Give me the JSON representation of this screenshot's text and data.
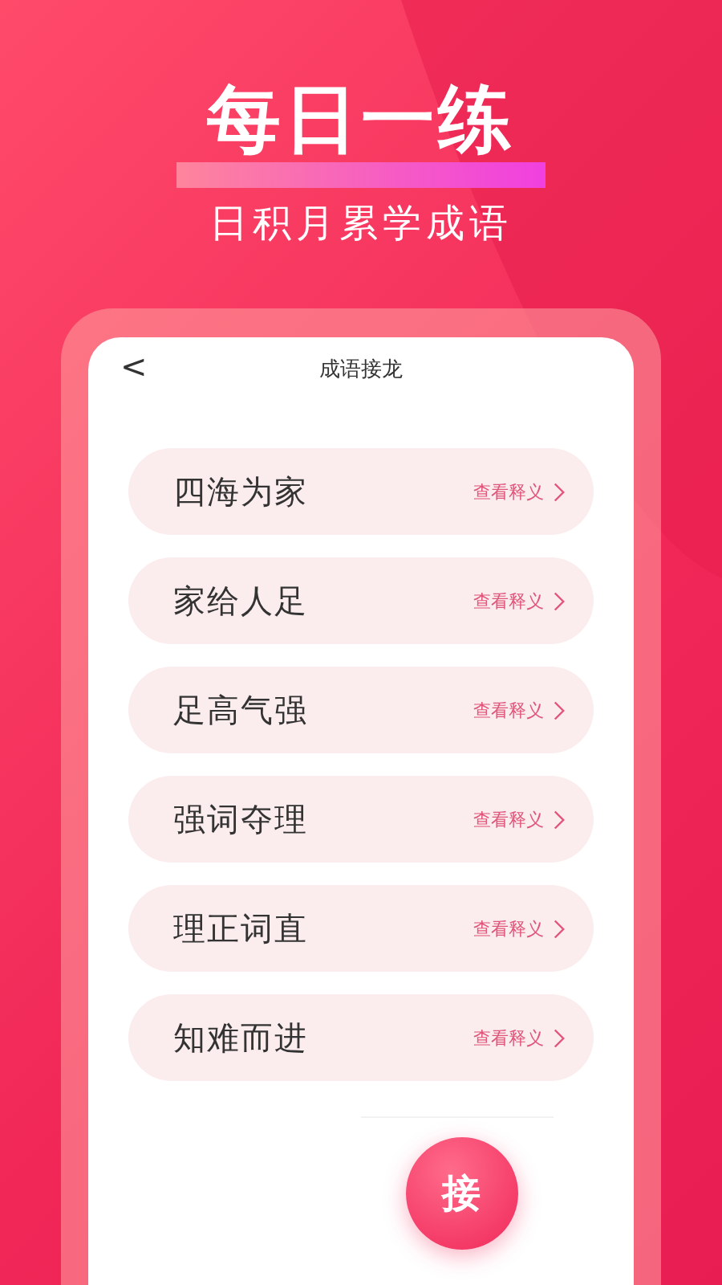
{
  "headline": "每日一练",
  "subtitle": "日积月累学成语",
  "screen": {
    "back": "<",
    "title": "成语接龙",
    "idioms": [
      {
        "text": "四海为家",
        "action": "查看释义"
      },
      {
        "text": "家给人足",
        "action": "查看释义"
      },
      {
        "text": "足高气强",
        "action": "查看释义"
      },
      {
        "text": "强词夺理",
        "action": "查看释义"
      },
      {
        "text": "理正词直",
        "action": "查看释义"
      },
      {
        "text": "知难而进",
        "action": "查看释义"
      }
    ],
    "fab": "接"
  }
}
